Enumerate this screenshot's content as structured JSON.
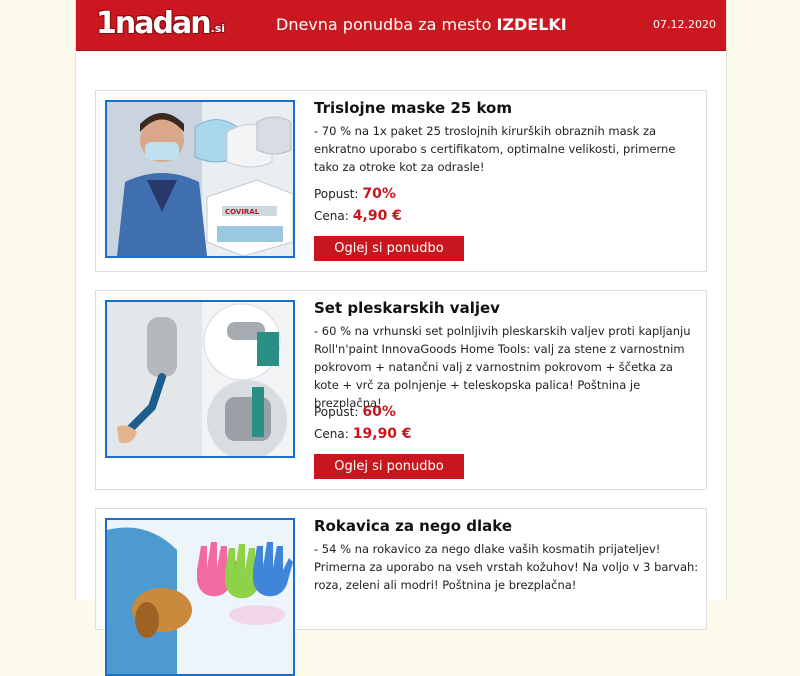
{
  "header": {
    "logo_main": "1nadan",
    "logo_tld": ".si",
    "title_prefix": "Dnevna ponudba za mesto ",
    "title_city": "IZDELKI",
    "date": "07.12.2020"
  },
  "labels": {
    "discount": "Popust:",
    "price": "Cena:",
    "button": "Oglej si ponudbo"
  },
  "offers": [
    {
      "title": "Trislojne maske 25 kom",
      "description": "- 70 % na 1x paket 25 troslojnih kirurških obraznih mask za enkratno uporabo s certifikatom, optimalne velikosti, primerne tako za otroke kot za odrasle!",
      "discount": "70%",
      "price": "4,90 €",
      "image_brand": "COVIRAL",
      "image_icon": "face-mask-icon"
    },
    {
      "title": "Set pleskarskih valjev",
      "description": "- 60 % na vrhunski set polnljivih pleskarskih valjev proti kapljanju Roll'n'paint InnovaGoods Home Tools: valj za stene z varnostnim pokrovom + natančni valj z varnostnim pokrovom + ščetka za kote + vrč za polnjenje + teleskopska palica! Poštnina je brezplačna!",
      "discount": "60%",
      "price": "19,90 €",
      "image_icon": "paint-roller-icon"
    },
    {
      "title": "Rokavica za nego dlake",
      "description": "- 54 % na rokavico za nego dlake vaših kosmatih prijateljev! Primerna za uporabo na vseh vrstah kožuhov! Na voljo v 3 barvah: roza, zeleni ali modri! Poštnina je brezplačna!",
      "image_icon": "grooming-glove-icon"
    }
  ],
  "colors": {
    "brand_red": "#cb1820",
    "accent_blue": "#1a6fcc",
    "page_bg": "#fcfbec"
  }
}
